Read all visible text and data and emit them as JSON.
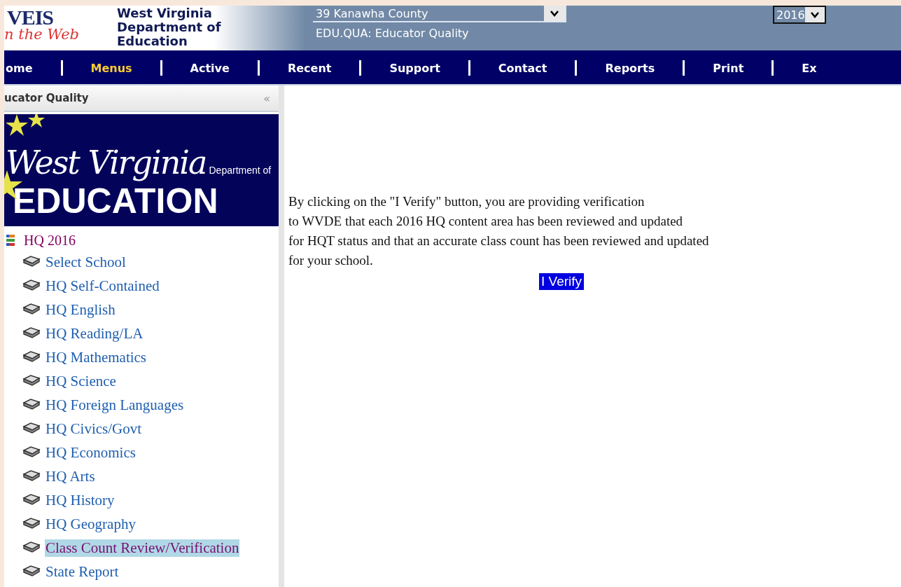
{
  "header": {
    "logo": {
      "title": "VEIS",
      "subtitle": "n the Web"
    },
    "department": [
      "West Virginia",
      "Department of",
      "Education"
    ],
    "district_select": {
      "value": "39 Kanawha County"
    },
    "module": "EDU.QUA: Educator Quality",
    "year_select": {
      "value": "2016"
    }
  },
  "nav": [
    {
      "label": "ome",
      "selected": false
    },
    {
      "label": "Menus",
      "selected": true
    },
    {
      "label": "Active",
      "selected": false
    },
    {
      "label": "Recent",
      "selected": false
    },
    {
      "label": "Support",
      "selected": false
    },
    {
      "label": "Contact",
      "selected": false
    },
    {
      "label": "Reports",
      "selected": false
    },
    {
      "label": "Print",
      "selected": false
    },
    {
      "label": "Ex",
      "selected": false
    }
  ],
  "sidebar": {
    "title": "ucator Quality",
    "collapse": "«",
    "banner": {
      "script": "West Virginia",
      "small": "Department of",
      "big": "EDUCATION"
    },
    "tree": [
      {
        "label": "HQ 2016",
        "selected": false,
        "children": [
          {
            "label": "Select School",
            "selected": false
          },
          {
            "label": "HQ Self-Contained",
            "selected": false
          },
          {
            "label": "HQ English",
            "selected": false
          },
          {
            "label": "HQ Reading/LA",
            "selected": false
          },
          {
            "label": "HQ Mathematics",
            "selected": false
          },
          {
            "label": "HQ Science",
            "selected": false
          },
          {
            "label": "HQ Foreign Languages",
            "selected": false
          },
          {
            "label": "HQ Civics/Govt",
            "selected": false
          },
          {
            "label": "HQ Economics",
            "selected": false
          },
          {
            "label": "HQ Arts",
            "selected": false
          },
          {
            "label": "HQ History",
            "selected": false
          },
          {
            "label": "HQ Geography",
            "selected": false
          },
          {
            "label": "Class Count Review/Verification",
            "selected": true
          },
          {
            "label": "State Report",
            "selected": false
          }
        ]
      }
    ]
  },
  "main": {
    "message_lines": [
      "By clicking on the \"I Verify\" button, you are providing verification",
      "to WVDE that each 2016 HQ content area has been reviewed and updated",
      "for HQT status and that an accurate class count has been reviewed and updated",
      "for your school."
    ],
    "button": "I Verify"
  }
}
